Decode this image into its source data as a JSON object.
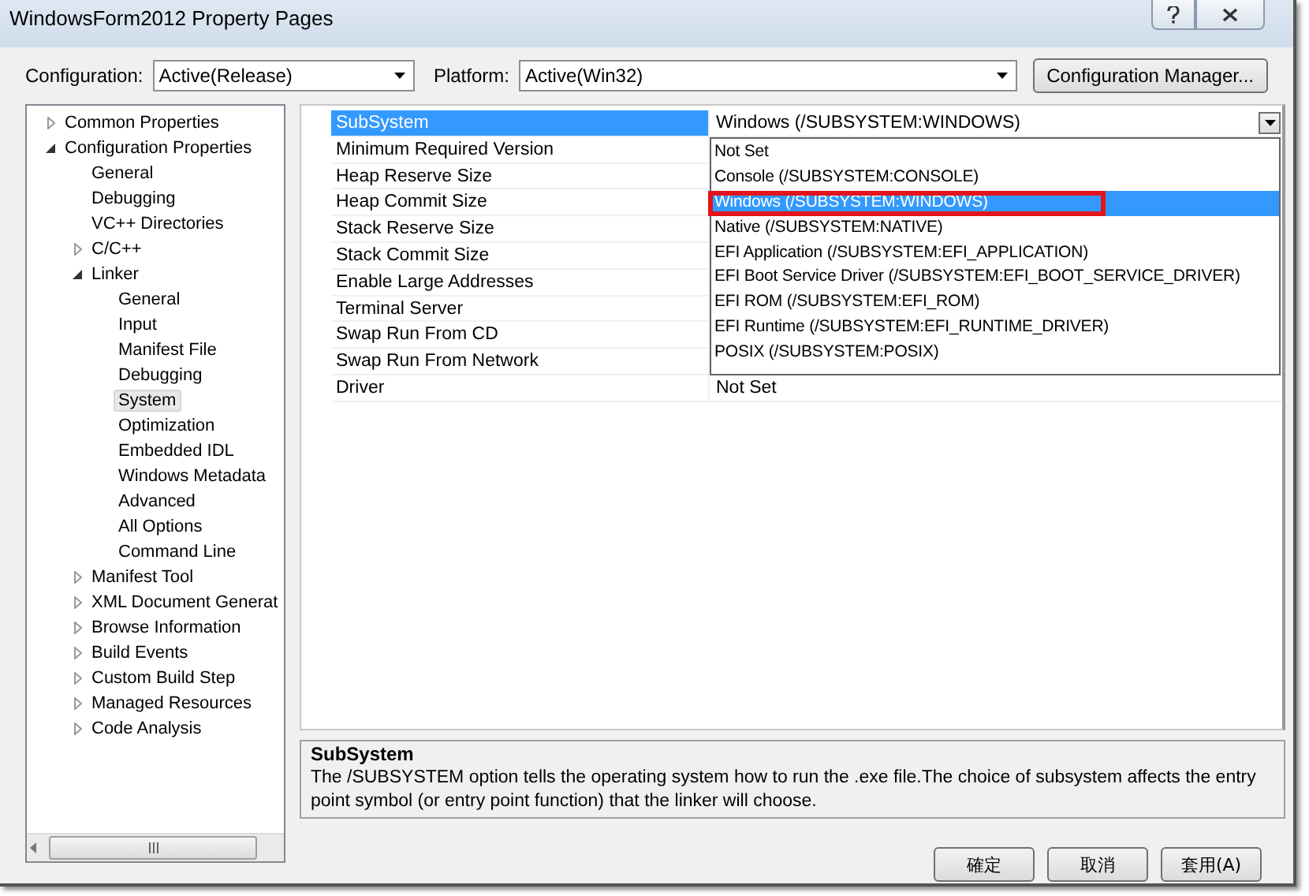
{
  "window": {
    "title": "WindowsForm2012 Property Pages"
  },
  "config_bar": {
    "configuration": {
      "label": "Configuration:",
      "value": "Active(Release)"
    },
    "platform": {
      "label": "Platform:",
      "value": "Active(Win32)"
    },
    "manager_button": "Configuration Manager..."
  },
  "tree": {
    "items": [
      {
        "label": "Common Properties",
        "expanded": false,
        "selected": false
      },
      {
        "label": "Configuration Properties",
        "expanded": true,
        "selected": false,
        "children": [
          {
            "label": "General",
            "selected": false
          },
          {
            "label": "Debugging",
            "selected": false
          },
          {
            "label": "VC++ Directories",
            "selected": false
          },
          {
            "label": "C/C++",
            "expanded": false,
            "selected": false
          },
          {
            "label": "Linker",
            "expanded": true,
            "selected": false,
            "children": [
              {
                "label": "General",
                "selected": false
              },
              {
                "label": "Input",
                "selected": false
              },
              {
                "label": "Manifest File",
                "selected": false
              },
              {
                "label": "Debugging",
                "selected": false
              },
              {
                "label": "System",
                "selected": true
              },
              {
                "label": "Optimization",
                "selected": false
              },
              {
                "label": "Embedded IDL",
                "selected": false
              },
              {
                "label": "Windows Metadata",
                "selected": false
              },
              {
                "label": "Advanced",
                "selected": false
              },
              {
                "label": "All Options",
                "selected": false
              },
              {
                "label": "Command Line",
                "selected": false
              }
            ]
          },
          {
            "label": "Manifest Tool",
            "expanded": false,
            "selected": false
          },
          {
            "label": "XML Document Generat",
            "expanded": false,
            "selected": false
          },
          {
            "label": "Browse Information",
            "expanded": false,
            "selected": false
          },
          {
            "label": "Build Events",
            "expanded": false,
            "selected": false
          },
          {
            "label": "Custom Build Step",
            "expanded": false,
            "selected": false
          },
          {
            "label": "Managed Resources",
            "expanded": false,
            "selected": false
          },
          {
            "label": "Code Analysis",
            "expanded": false,
            "selected": false
          }
        ]
      }
    ]
  },
  "grid": {
    "rows": [
      {
        "name": "SubSystem",
        "kind": "dropdown",
        "value": "Windows (/SUBSYSTEM:WINDOWS)",
        "selected": true
      },
      {
        "name": "Minimum Required Version",
        "kind": "text",
        "selected": false
      },
      {
        "name": "Heap Reserve Size",
        "kind": "text",
        "selected": false
      },
      {
        "name": "Heap Commit Size",
        "kind": "text",
        "selected": false
      },
      {
        "name": "Stack Reserve Size",
        "kind": "text",
        "selected": false
      },
      {
        "name": "Stack Commit Size",
        "kind": "text",
        "selected": false
      },
      {
        "name": "Enable Large Addresses",
        "kind": "text",
        "selected": false
      },
      {
        "name": "Terminal Server",
        "kind": "text",
        "selected": false
      },
      {
        "name": "Swap Run From CD",
        "kind": "text",
        "selected": false
      },
      {
        "name": "Swap Run From Network",
        "kind": "text",
        "selected": false
      },
      {
        "name": "Driver",
        "kind": "text",
        "value": "Not Set",
        "selected": false
      }
    ],
    "dropdown_options": [
      {
        "label": "Not Set",
        "selected": false,
        "highlighted": false
      },
      {
        "label": "Console (/SUBSYSTEM:CONSOLE)",
        "selected": false,
        "highlighted": false
      },
      {
        "label": "Windows (/SUBSYSTEM:WINDOWS)",
        "selected": true,
        "highlighted": true
      },
      {
        "label": "Native (/SUBSYSTEM:NATIVE)",
        "selected": false,
        "highlighted": false
      },
      {
        "label": "EFI Application (/SUBSYSTEM:EFI_APPLICATION)",
        "selected": false,
        "highlighted": false
      },
      {
        "label": "EFI Boot Service Driver (/SUBSYSTEM:EFI_BOOT_SERVICE_DRIVER)",
        "selected": false,
        "highlighted": false
      },
      {
        "label": "EFI ROM (/SUBSYSTEM:EFI_ROM)",
        "selected": false,
        "highlighted": false
      },
      {
        "label": "EFI Runtime (/SUBSYSTEM:EFI_RUNTIME_DRIVER)",
        "selected": false,
        "highlighted": false
      },
      {
        "label": "POSIX (/SUBSYSTEM:POSIX)",
        "selected": false,
        "highlighted": false
      }
    ]
  },
  "description": {
    "title": "SubSystem",
    "text": "The /SUBSYSTEM option tells the operating system how to run the .exe file.The choice of subsystem affects the entry point symbol (or entry point function) that the linker will choose."
  },
  "buttons": [
    "確定",
    "取消",
    "套用(A)"
  ]
}
